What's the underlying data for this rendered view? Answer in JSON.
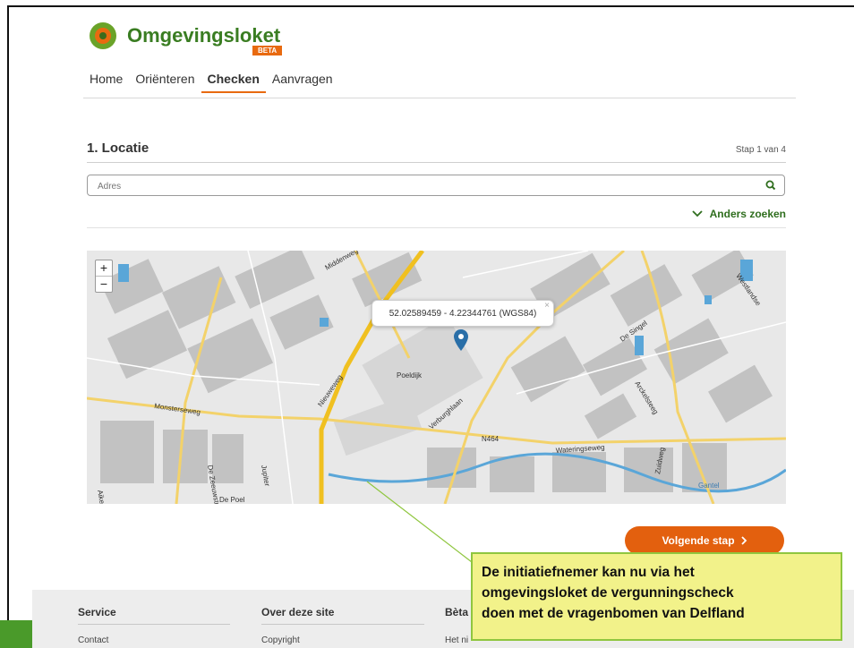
{
  "logo": {
    "name_part1": "Omgevings",
    "name_part2": "loket",
    "badge": "BETA"
  },
  "nav": {
    "items": [
      "Home",
      "Oriënteren",
      "Checken",
      "Aanvragen"
    ],
    "active_index": 2
  },
  "step": {
    "title": "1. Locatie",
    "counter": "Stap 1 van 4"
  },
  "search": {
    "placeholder": "Adres",
    "icon": "search-icon"
  },
  "anders": {
    "label": "Anders zoeken",
    "icon": "chevron-down-icon"
  },
  "map": {
    "zoom_in": "+",
    "zoom_out": "−",
    "popup_text": "52.02589459 - 4.22344761 (WGS84)",
    "popup_close": "×",
    "labels": [
      "Middenweg",
      "Monsterseweg",
      "Poeldijk",
      "Nieuweweg",
      "Verburghlaan",
      "N464",
      "Wateringseweg",
      "De Poel",
      "De Zeeuwstraat",
      "Jupiter",
      "Zuidweg",
      "De Singel",
      "Arckelsteeg",
      "Westlandse",
      "Gantel",
      "Aike"
    ]
  },
  "next_button": {
    "label": "Volgende stap",
    "icon": "chevron-right-icon"
  },
  "footer": {
    "columns": [
      {
        "title": "Service",
        "link": "Contact"
      },
      {
        "title": "Over deze site",
        "link": "Copyright"
      },
      {
        "title": "Bèta",
        "link": "Het ni"
      }
    ]
  },
  "callout": {
    "lines": [
      "De initiatiefnemer kan nu via het",
      "omgevingsloket de vergunningscheck",
      "doen met de vragenbomen van Delfland"
    ]
  },
  "colors": {
    "brand_green": "#3a7d22",
    "accent_orange": "#e3600e",
    "callout_bg": "#f2f28a",
    "callout_border": "#8fc63f"
  }
}
